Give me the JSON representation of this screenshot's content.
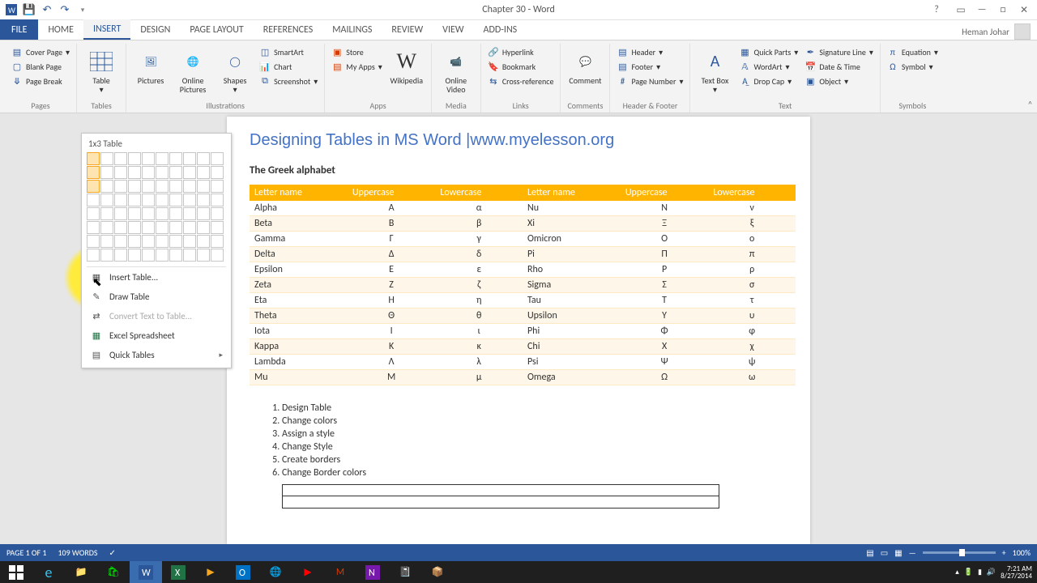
{
  "title": "Chapter 30 - Word",
  "user": "Heman Johar",
  "tabs": [
    "FILE",
    "HOME",
    "INSERT",
    "DESIGN",
    "PAGE LAYOUT",
    "REFERENCES",
    "MAILINGS",
    "REVIEW",
    "VIEW",
    "ADD-INS"
  ],
  "active_tab": 2,
  "ribbon": {
    "pages": {
      "label": "Pages",
      "cover": "Cover Page",
      "blank": "Blank Page",
      "break": "Page Break"
    },
    "tables": {
      "label": "Tables",
      "btn": "Table"
    },
    "illus": {
      "label": "Illustrations",
      "pictures": "Pictures",
      "online": "Online Pictures",
      "shapes": "Shapes",
      "smartart": "SmartArt",
      "chart": "Chart",
      "screenshot": "Screenshot"
    },
    "apps": {
      "label": "Apps",
      "store": "Store",
      "myapps": "My Apps",
      "wiki": "Wikipedia"
    },
    "media": {
      "label": "Media",
      "video": "Online Video"
    },
    "links": {
      "label": "Links",
      "hyper": "Hyperlink",
      "book": "Bookmark",
      "cross": "Cross-reference"
    },
    "comments": {
      "label": "Comments",
      "btn": "Comment"
    },
    "hf": {
      "label": "Header & Footer",
      "header": "Header",
      "footer": "Footer",
      "pagenum": "Page Number"
    },
    "text": {
      "label": "Text",
      "textbox": "Text Box",
      "quick": "Quick Parts",
      "wordart": "WordArt",
      "drop": "Drop Cap",
      "sig": "Signature Line",
      "date": "Date & Time",
      "object": "Object"
    },
    "symbols": {
      "label": "Symbols",
      "eq": "Equation",
      "sym": "Symbol"
    }
  },
  "table_drop": {
    "title": "1x3 Table",
    "insert": "Insert Table...",
    "draw": "Draw Table",
    "convert": "Convert Text to Table...",
    "excel": "Excel Spreadsheet",
    "quick": "Quick Tables"
  },
  "doc": {
    "title": "Designing Tables in MS Word |www.myelesson.org",
    "subhead": "The Greek alphabet",
    "headers": [
      "Letter name",
      "Uppercase",
      "Lowercase",
      "Letter name",
      "Uppercase",
      "Lowercase"
    ],
    "rows": [
      [
        "Alpha",
        "Α",
        "α",
        "Nu",
        "Ν",
        "ν"
      ],
      [
        "Beta",
        "Β",
        "β",
        "Xi",
        "Ξ",
        "ξ"
      ],
      [
        "Gamma",
        "Γ",
        "γ",
        "Omicron",
        "Ο",
        "ο"
      ],
      [
        "Delta",
        "Δ",
        "δ",
        "Pi",
        "Π",
        "π"
      ],
      [
        "Epsilon",
        "Ε",
        "ε",
        "Rho",
        "Ρ",
        "ρ"
      ],
      [
        "Zeta",
        "Ζ",
        "ζ",
        "Sigma",
        "Σ",
        "σ"
      ],
      [
        "Eta",
        "Η",
        "η",
        "Tau",
        "Τ",
        "τ"
      ],
      [
        "Theta",
        "Θ",
        "θ",
        "Upsilon",
        "Υ",
        "υ"
      ],
      [
        "Iota",
        "Ι",
        "ι",
        "Phi",
        "Φ",
        "φ"
      ],
      [
        "Kappa",
        "Κ",
        "κ",
        "Chi",
        "Χ",
        "χ"
      ],
      [
        "Lambda",
        "Λ",
        "λ",
        "Psi",
        "Ψ",
        "ψ"
      ],
      [
        "Mu",
        "Μ",
        "μ",
        "Omega",
        "Ω",
        "ω"
      ]
    ],
    "list": [
      "Design Table",
      "Change colors",
      "Assign a style",
      "Change Style",
      "Create borders",
      "Change Border colors"
    ]
  },
  "status": {
    "page": "PAGE 1 OF 1",
    "words": "109 WORDS",
    "zoom": "100%"
  },
  "clock": {
    "time": "7:21 AM",
    "date": "8/27/2014"
  }
}
